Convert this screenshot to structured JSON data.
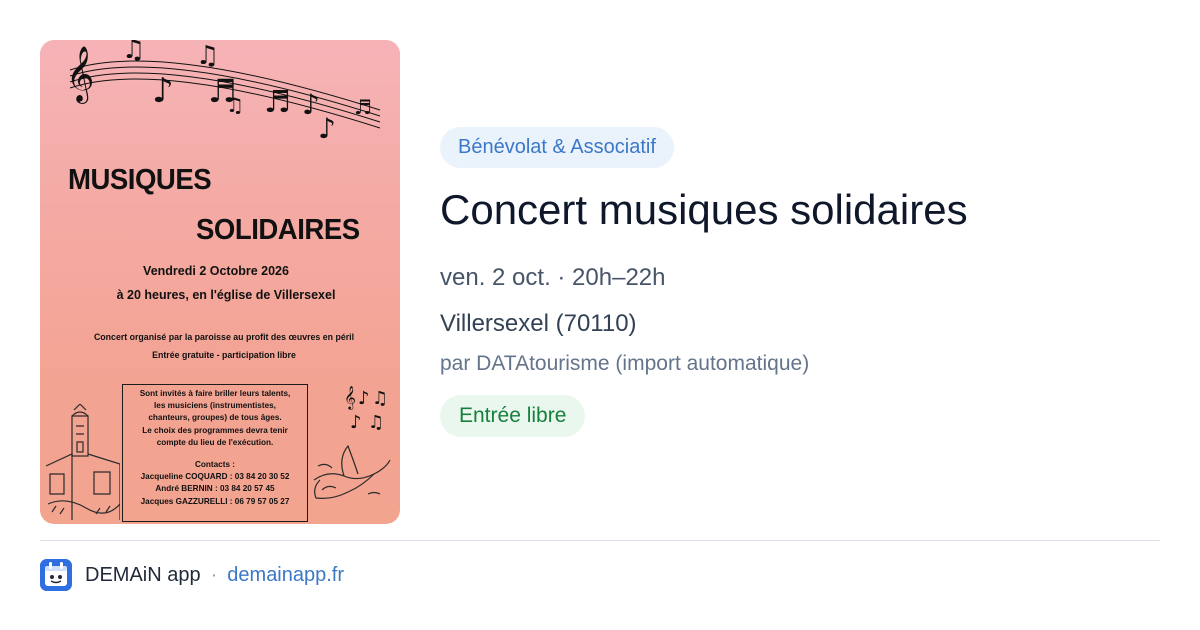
{
  "poster": {
    "title_line1": "MUSIQUES",
    "title_line2": "SOLIDAIRES",
    "date_line": "Vendredi 2 Octobre 2026",
    "time_place_line": "à 20 heures, en l'église de Villersexel",
    "organiser_line": "Concert organisé par la paroisse au profit des œuvres en péril",
    "entry_line": "Entrée gratuite - participation libre",
    "invite_lines": [
      "Sont invités à faire briller leurs talents,",
      "les musiciens (instrumentistes,",
      "chanteurs, groupes) de tous âges.",
      "Le choix des programmes devra tenir",
      "compte du lieu de l'exécution."
    ],
    "contacts_heading": "Contacts :",
    "contacts": [
      "Jacqueline COQUARD : 03 84 20 30 52",
      "André BERNIN : 03 84 20 57 45",
      "Jacques GAZZURELLI : 06 79 57 05 27"
    ]
  },
  "event": {
    "category": "Bénévolat & Associatif",
    "title": "Concert musiques solidaires",
    "datetime": "ven. 2 oct. · 20h–22h",
    "location": "Villersexel (70110)",
    "source": "par DATAtourisme (import automatique)",
    "price": "Entrée libre"
  },
  "footer": {
    "app_name": "DEMAiN app",
    "separator": "·",
    "url": "demainapp.fr"
  },
  "colors": {
    "accent_blue": "#3b78c8",
    "category_bg": "#eaf2fb",
    "price_green": "#16803c",
    "price_bg": "#eaf7ee",
    "app_icon": "#2f6fe0"
  }
}
